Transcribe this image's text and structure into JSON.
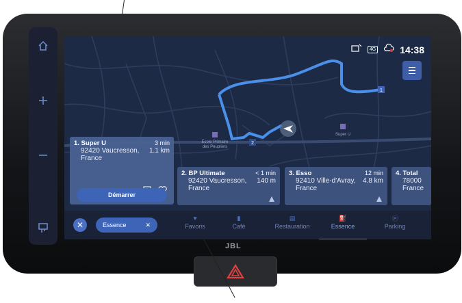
{
  "status": {
    "time": "14:38",
    "network": "4G"
  },
  "map": {
    "pois": [
      {
        "label_lines": [
          "École Primaire",
          "des Peupliers"
        ]
      },
      {
        "label_lines": [
          "Super U"
        ]
      }
    ],
    "route_markers": [
      "1",
      "2"
    ]
  },
  "side_rail": {
    "icons": [
      "home-icon",
      "zoom-in-icon",
      "zoom-out-icon",
      "display-mode-icon"
    ]
  },
  "results": [
    {
      "title": "1. Super U",
      "time": "3 min",
      "address": "92420 Vaucresson,",
      "distance": "1.1 km",
      "country": "France",
      "action": "Démarrer"
    },
    {
      "title": "2. BP Ultimate",
      "time": "< 1 min",
      "address": "92420 Vaucresson,",
      "distance": "140 m",
      "country": "France"
    },
    {
      "title": "3. Esso",
      "time": "12 min",
      "address": "92410 Ville-d'Avray,",
      "distance": "4.8 km",
      "country": "France"
    },
    {
      "title": "4. Total",
      "time": "",
      "address": "78000",
      "distance": "",
      "country": "France"
    }
  ],
  "filter": {
    "chip_label": "Essence"
  },
  "categories": [
    {
      "label": "Favoris",
      "icon": "heart-icon"
    },
    {
      "label": "Café",
      "icon": "coffee-icon"
    },
    {
      "label": "Restauration",
      "icon": "restaurant-icon"
    },
    {
      "label": "Essence",
      "icon": "fuel-icon",
      "active": true
    },
    {
      "label": "Parking",
      "icon": "parking-icon"
    }
  ],
  "hardware": {
    "brand": "JBL"
  },
  "colors": {
    "accent": "#3e64b7",
    "route": "#4a8fe8",
    "background": "#1d2a45"
  }
}
